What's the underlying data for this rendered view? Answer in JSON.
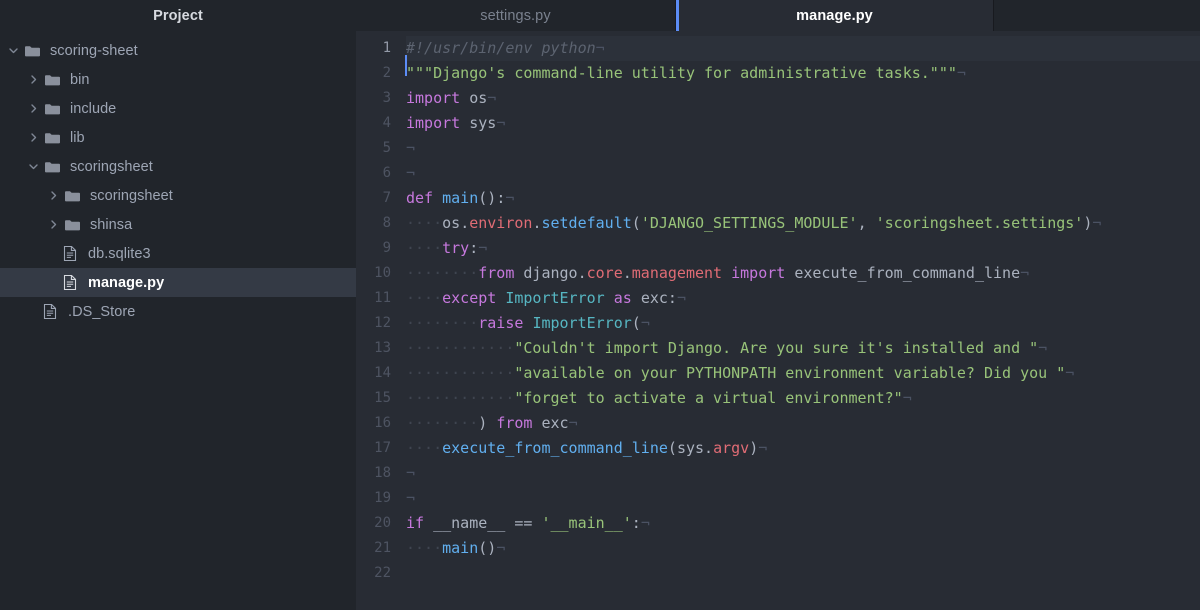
{
  "sidebar": {
    "title": "Project",
    "items": [
      {
        "label": "scoring-sheet",
        "kind": "folder",
        "twisty": "chevron-down-icon",
        "depth": 0,
        "selected": false
      },
      {
        "label": "bin",
        "kind": "folder",
        "twisty": "chevron-right-icon",
        "depth": 1,
        "selected": false
      },
      {
        "label": "include",
        "kind": "folder",
        "twisty": "chevron-right-icon",
        "depth": 1,
        "selected": false
      },
      {
        "label": "lib",
        "kind": "folder",
        "twisty": "chevron-right-icon",
        "depth": 1,
        "selected": false
      },
      {
        "label": "scoringsheet",
        "kind": "folder",
        "twisty": "chevron-down-icon",
        "depth": 1,
        "selected": false
      },
      {
        "label": "scoringsheet",
        "kind": "folder",
        "twisty": "chevron-right-icon",
        "depth": 2,
        "selected": false
      },
      {
        "label": "shinsa",
        "kind": "folder",
        "twisty": "chevron-right-icon",
        "depth": 2,
        "selected": false
      },
      {
        "label": "db.sqlite3",
        "kind": "file",
        "twisty": "none",
        "depth": 2,
        "selected": false
      },
      {
        "label": "manage.py",
        "kind": "file",
        "twisty": "none",
        "depth": 2,
        "selected": true
      },
      {
        "label": ".DS_Store",
        "kind": "file",
        "twisty": "none",
        "depth": 1,
        "selected": false
      }
    ]
  },
  "tabs": [
    {
      "label": "settings.py",
      "active": false
    },
    {
      "label": "manage.py",
      "active": true
    }
  ],
  "editor": {
    "active_line": 1,
    "line_numbers": [
      "1",
      "2",
      "3",
      "4",
      "5",
      "6",
      "7",
      "8",
      "9",
      "10",
      "11",
      "12",
      "13",
      "14",
      "15",
      "16",
      "17",
      "18",
      "19",
      "20",
      "21",
      "22"
    ],
    "lines": [
      {
        "n": 1,
        "text": "#!/usr/bin/env python"
      },
      {
        "n": 2,
        "text": "\"\"\"Django's command-line utility for administrative tasks.\"\"\""
      },
      {
        "n": 3,
        "text": "import os"
      },
      {
        "n": 4,
        "text": "import sys"
      },
      {
        "n": 5,
        "text": ""
      },
      {
        "n": 6,
        "text": ""
      },
      {
        "n": 7,
        "text": "def main():"
      },
      {
        "n": 8,
        "text": "    os.environ.setdefault('DJANGO_SETTINGS_MODULE', 'scoringsheet.settings')"
      },
      {
        "n": 9,
        "text": "    try:"
      },
      {
        "n": 10,
        "text": "        from django.core.management import execute_from_command_line"
      },
      {
        "n": 11,
        "text": "    except ImportError as exc:"
      },
      {
        "n": 12,
        "text": "        raise ImportError("
      },
      {
        "n": 13,
        "text": "            \"Couldn't import Django. Are you sure it's installed and \""
      },
      {
        "n": 14,
        "text": "            \"available on your PYTHONPATH environment variable? Did you \""
      },
      {
        "n": 15,
        "text": "            \"forget to activate a virtual environment?\""
      },
      {
        "n": 16,
        "text": "        ) from exc"
      },
      {
        "n": 17,
        "text": "    execute_from_command_line(sys.argv)"
      },
      {
        "n": 18,
        "text": ""
      },
      {
        "n": 19,
        "text": ""
      },
      {
        "n": 20,
        "text": "if __name__ == '__main__':"
      },
      {
        "n": 21,
        "text": "    main()"
      },
      {
        "n": 22,
        "text": ""
      }
    ],
    "eol_marker": "¬",
    "indent_marker": "·"
  },
  "colors": {
    "sidebar_bg": "#21252b",
    "editor_bg": "#282c34",
    "selection_bg": "#343a45",
    "active_line_bg": "#2c313a",
    "accent": "#5c8df6",
    "comment": "#5c6370",
    "string": "#98c379",
    "keyword": "#c678dd",
    "function": "#61afef",
    "variable": "#e06c75",
    "class": "#56b6c2",
    "text": "#abb2bf",
    "line_number": "#4e5462"
  }
}
